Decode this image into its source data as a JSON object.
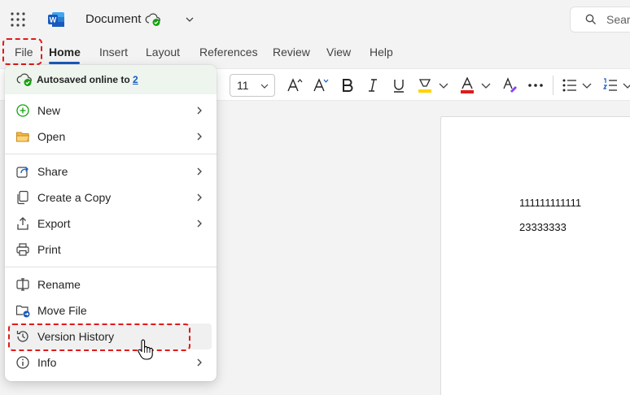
{
  "titlebar": {
    "app_icon": "word-logo-icon",
    "document_title": "Document",
    "save_status_icon": "cloud-check-icon",
    "search_placeholder": "Search"
  },
  "ribbon_tabs": [
    {
      "label": "File"
    },
    {
      "label": "Home",
      "active": true
    },
    {
      "label": "Insert"
    },
    {
      "label": "Layout"
    },
    {
      "label": "References"
    },
    {
      "label": "Review"
    },
    {
      "label": "View"
    },
    {
      "label": "Help"
    }
  ],
  "toolbar": {
    "font_size": "11"
  },
  "document": {
    "lines": [
      "111111111111",
      "23333333"
    ]
  },
  "file_menu": {
    "autosave_text": "Autosaved online to ",
    "autosave_link": "2",
    "items": [
      {
        "label": "New",
        "icon": "plus-circle-icon",
        "submenu": true
      },
      {
        "label": "Open",
        "icon": "folder-icon",
        "submenu": true
      },
      {
        "label": "Share",
        "icon": "share-icon",
        "submenu": true
      },
      {
        "label": "Create a Copy",
        "icon": "copy-icon",
        "submenu": true
      },
      {
        "label": "Export",
        "icon": "export-icon",
        "submenu": true
      },
      {
        "label": "Print",
        "icon": "printer-icon",
        "submenu": false
      },
      {
        "label": "Rename",
        "icon": "rename-icon",
        "submenu": false
      },
      {
        "label": "Move File",
        "icon": "move-file-icon",
        "submenu": false
      },
      {
        "label": "Version History",
        "icon": "history-icon",
        "submenu": false,
        "hovered": true
      },
      {
        "label": "Info",
        "icon": "info-icon",
        "submenu": true
      }
    ]
  },
  "colors": {
    "accent": "#185abd",
    "highlight_dash": "#e01b1b",
    "autosave_bg": "#edf5ee"
  }
}
